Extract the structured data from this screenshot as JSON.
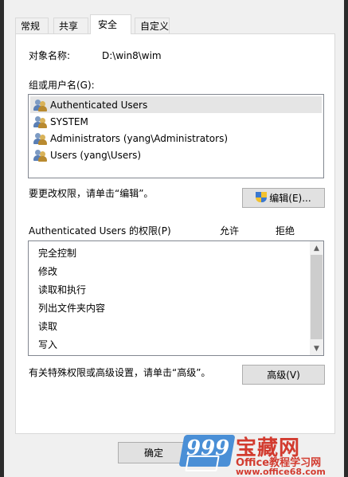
{
  "tabs": [
    {
      "label": "常规"
    },
    {
      "label": "共享"
    },
    {
      "label": "安全"
    },
    {
      "label": "自定义"
    }
  ],
  "object": {
    "label": "对象名称:",
    "value": "D:\\win8\\wim"
  },
  "groups": {
    "label": "组或用户名(G):",
    "items": [
      {
        "name": "Authenticated Users"
      },
      {
        "name": "SYSTEM"
      },
      {
        "name": "Administrators (yang\\Administrators)"
      },
      {
        "name": "Users (yang\\Users)"
      }
    ]
  },
  "change_hint": "要更改权限，请单击“编辑”。",
  "edit_button": "编辑(E)...",
  "permissions": {
    "header": "Authenticated Users 的权限(P)",
    "allow": "允许",
    "deny": "拒绝",
    "items": [
      {
        "name": "完全控制"
      },
      {
        "name": "修改"
      },
      {
        "name": "读取和执行"
      },
      {
        "name": "列出文件夹内容"
      },
      {
        "name": "读取"
      },
      {
        "name": "写入"
      }
    ]
  },
  "advanced_hint": "有关特殊权限或高级设置，请单击“高级”。",
  "advanced_button": "高级(V)",
  "ok_button": "确定",
  "watermark": {
    "num": "999",
    "big": "宝藏网",
    "sub": "Office教程学习网",
    "url": "www.office68.com"
  }
}
